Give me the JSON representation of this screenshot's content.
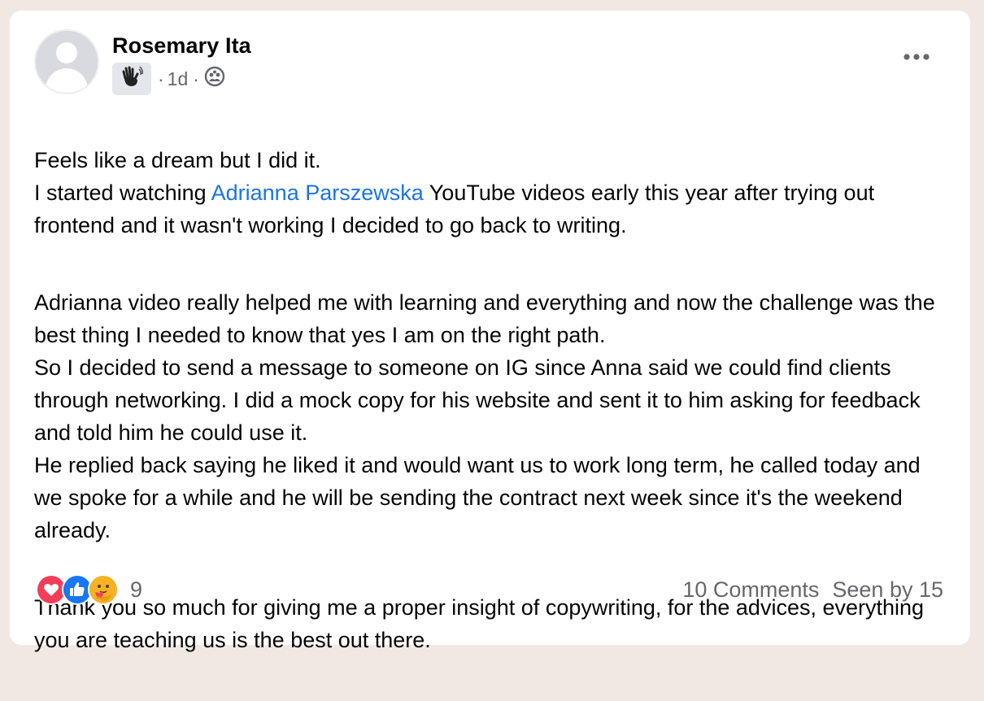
{
  "post": {
    "author": "Rosemary Ita",
    "time": "1d",
    "separator": "·",
    "paragraph1_line1": "Feels like a dream but I did it.",
    "paragraph1_before_mention": "I started watching ",
    "mention": "Adrianna Parszewska",
    "paragraph1_after_mention": " YouTube videos early this year after trying out frontend and it wasn't working I decided to go back to writing.",
    "paragraph2": "Adrianna video really helped me with learning and everything and now the challenge was the best thing I needed to know that yes I am on the right path.\nSo I decided to send a message to someone on IG since Anna said we could find clients through networking. I did a mock copy for his website and sent it to him asking for feedback and told him he could use it.\nHe replied back saying he liked it and would want us to work long term, he called today and we spoke for a while and he will be sending the contract next week since it's the weekend already.",
    "paragraph3": "Thank you so much for giving me a proper insight of copywriting, for the advices, everything you are teaching us is the best out there."
  },
  "footer": {
    "reaction_count": "9",
    "comments": "10 Comments",
    "seen_by": "Seen by 15"
  },
  "icons": {
    "badge": "waving-hand-icon",
    "privacy": "group-icon",
    "more": "more-options-icon",
    "reactions": [
      "love-icon",
      "like-icon",
      "care-icon"
    ]
  },
  "colors": {
    "mention": "#1b74e4",
    "love": "#f33e58",
    "like": "#1877f2",
    "care": "#f7b125"
  }
}
